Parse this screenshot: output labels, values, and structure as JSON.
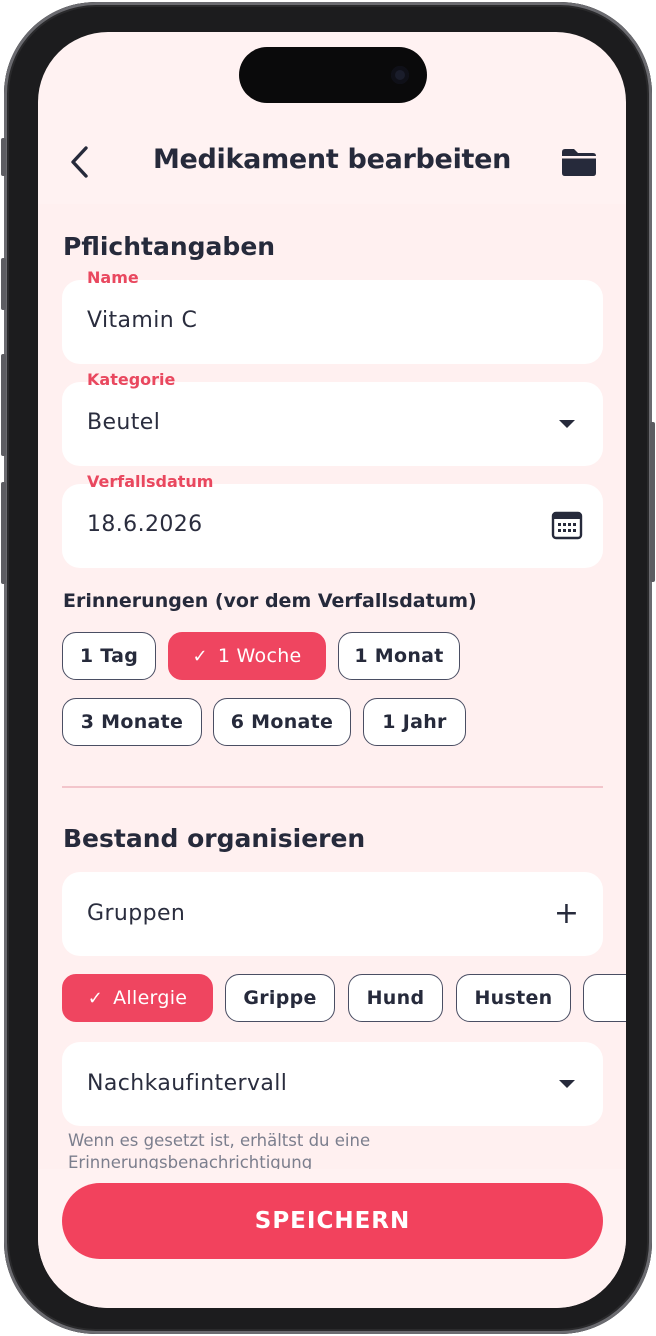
{
  "header": {
    "title": "Medikament bearbeiten",
    "back_icon": "chevron-left-icon",
    "folder_icon": "folder-icon"
  },
  "required": {
    "title": "Pflichtangaben",
    "name": {
      "label": "Name",
      "value": "Vitamin C"
    },
    "category": {
      "label": "Kategorie",
      "value": "Beutel"
    },
    "expiry": {
      "label": "Verfallsdatum",
      "value": "18.6.2026"
    }
  },
  "reminders": {
    "title": "Erinnerungen (vor dem Verfallsdatum)",
    "options": [
      "1 Tag",
      "1 Woche",
      "1 Monat",
      "3 Monate",
      "6 Monate",
      "1 Jahr"
    ],
    "selected": "1 Woche"
  },
  "stock": {
    "title": "Bestand organisieren",
    "groups_label": "Gruppen",
    "groups": [
      "Allergie",
      "Grippe",
      "Hund",
      "Husten"
    ],
    "selected_group": "Allergie",
    "repurchase_label": "Nachkaufintervall",
    "hint": "Wenn es gesetzt ist, erhältst du eine Erinnerungsbenachrichtigung"
  },
  "save_label": "SPEICHERN",
  "colors": {
    "accent": "#ef4560",
    "text": "#262a3b",
    "background": "#fff2f2"
  }
}
